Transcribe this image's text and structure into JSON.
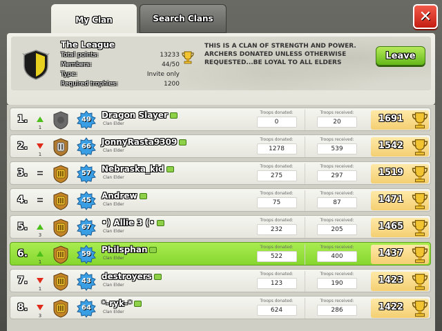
{
  "tabs": [
    {
      "label": "My Clan",
      "active": true
    },
    {
      "label": "Search Clans",
      "active": false
    }
  ],
  "close_icon": "close-x-icon",
  "clan": {
    "name": "The League",
    "stats": [
      {
        "label": "Total points:",
        "value": "13233"
      },
      {
        "label": "Members:",
        "value": "44/50"
      },
      {
        "label": "Type:",
        "value": "Invite only"
      },
      {
        "label": "Required trophies:",
        "value": "1200"
      }
    ],
    "description": "THIS IS A CLAN OF STRENGTH AND POWER. ARCHERS DONATED UNLESS OTHERWISE REQUESTED...BE LOYAL TO ALL ELDERS",
    "leave_label": "Leave",
    "badge_colors": {
      "primary": "#e8d020",
      "secondary": "#1a1a1a"
    }
  },
  "labels": {
    "troops_donated": "Troops donated:",
    "troops_received": "Troops received:"
  },
  "members": [
    {
      "rank": "1.",
      "change": "up",
      "change_count": "1",
      "league": "unranked",
      "level": "49",
      "name": "Dragon Slayer",
      "role": "Clan Elder",
      "donated": "0",
      "received": "20",
      "trophies": "1691",
      "highlight": false
    },
    {
      "rank": "2.",
      "change": "down",
      "change_count": "1",
      "league": "silver",
      "level": "66",
      "name": "JonnyRasta9309",
      "role": "Clan Elder",
      "donated": "1278",
      "received": "539",
      "trophies": "1542",
      "highlight": false
    },
    {
      "rank": "3.",
      "change": "same",
      "change_count": "",
      "league": "gold",
      "level": "57",
      "name": "Nebraska_kid",
      "role": "Clan Elder",
      "donated": "275",
      "received": "297",
      "trophies": "1519",
      "highlight": false
    },
    {
      "rank": "4.",
      "change": "same",
      "change_count": "",
      "league": "gold",
      "level": "45",
      "name": "Andrew",
      "role": "Clan Elder",
      "donated": "75",
      "received": "87",
      "trophies": "1471",
      "highlight": false
    },
    {
      "rank": "5.",
      "change": "up",
      "change_count": "3",
      "league": "gold",
      "level": "67",
      "name": "•) Allie 3 (•",
      "role": "Clan Elder",
      "donated": "232",
      "received": "205",
      "trophies": "1465",
      "highlight": false
    },
    {
      "rank": "6.",
      "change": "up",
      "change_count": "1",
      "league": "gold",
      "level": "59",
      "name": "Philsphan",
      "role": "Clan Elder",
      "donated": "522",
      "received": "400",
      "trophies": "1437",
      "highlight": true
    },
    {
      "rank": "7.",
      "change": "down",
      "change_count": "1",
      "league": "gold",
      "level": "43",
      "name": "destroyers",
      "role": "Clan Elder",
      "donated": "123",
      "received": "190",
      "trophies": "1423",
      "highlight": false
    },
    {
      "rank": "8.",
      "change": "down",
      "change_count": "3",
      "league": "gold",
      "level": "64",
      "name": "*-ryk-*",
      "role": "Clan Elder",
      "donated": "624",
      "received": "286",
      "trophies": "1422",
      "highlight": false
    }
  ]
}
